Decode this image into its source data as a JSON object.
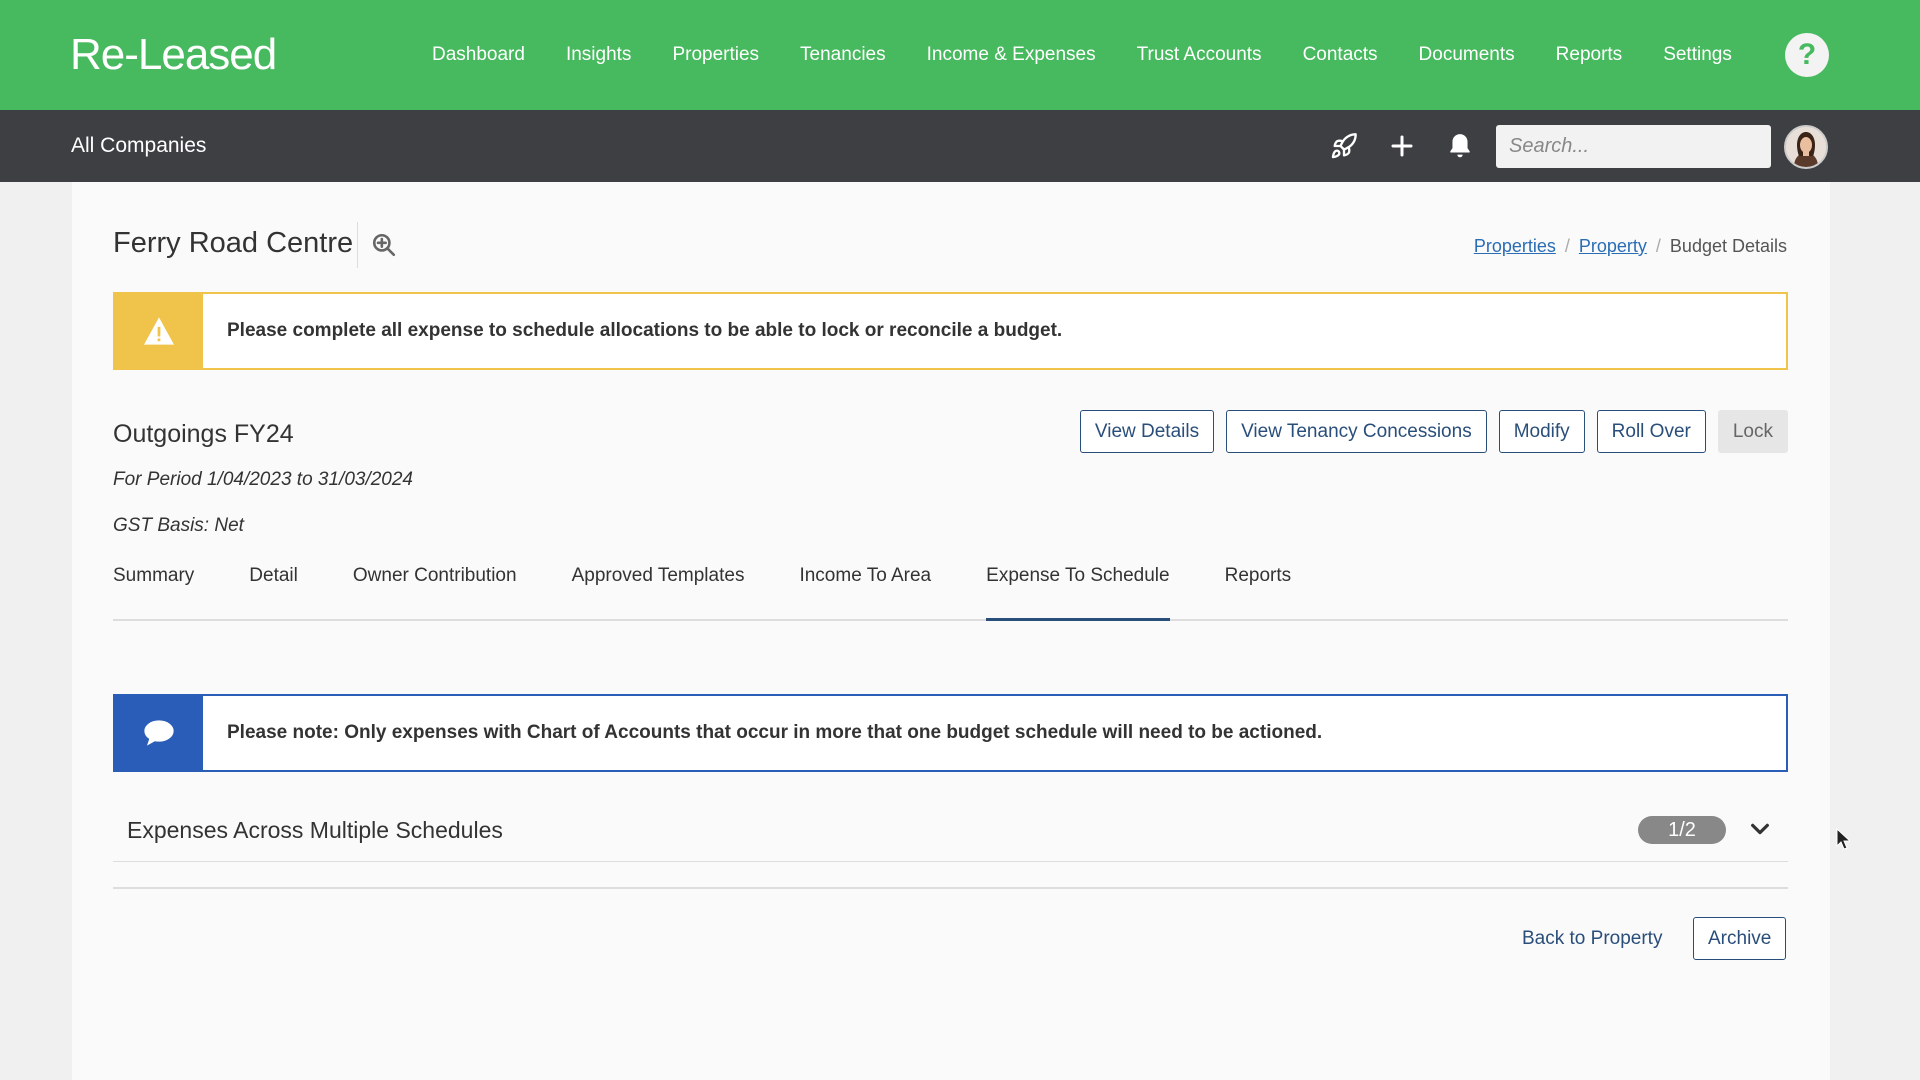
{
  "brand": {
    "logo_text": "Re-Leased"
  },
  "nav": {
    "items": [
      "Dashboard",
      "Insights",
      "Properties",
      "Tenancies",
      "Income & Expenses",
      "Trust Accounts",
      "Contacts",
      "Documents",
      "Reports",
      "Settings"
    ],
    "help_label": "?"
  },
  "subbar": {
    "company": "All Companies",
    "search_placeholder": "Search..."
  },
  "page": {
    "title": "Ferry Road Centre",
    "breadcrumb": {
      "items": [
        "Properties",
        "Property"
      ],
      "current": "Budget Details",
      "separator": "/"
    }
  },
  "warning": {
    "text": "Please complete all expense to schedule allocations to be able to lock or reconcile a budget."
  },
  "budget": {
    "title": "Outgoings FY24",
    "period": "For Period 1/04/2023 to 31/03/2024",
    "gst": "GST Basis: Net"
  },
  "actions": {
    "view_details": "View Details",
    "view_tenancy_concessions": "View Tenancy Concessions",
    "modify": "Modify",
    "roll_over": "Roll Over",
    "lock": "Lock"
  },
  "tabs": {
    "items": [
      "Summary",
      "Detail",
      "Owner Contribution",
      "Approved Templates",
      "Income To Area",
      "Expense To Schedule",
      "Reports"
    ],
    "active": "Expense To Schedule"
  },
  "note": {
    "text": "Please note: Only expenses with Chart of Accounts that occur in more that one budget schedule will need to be actioned."
  },
  "section": {
    "title": "Expenses Across Multiple Schedules",
    "pager": "1/2"
  },
  "footer": {
    "back_label": "Back to Property",
    "archive_label": "Archive"
  },
  "colors": {
    "brand_green": "#47b95e",
    "subbar": "#3d3f42",
    "warning": "#f0c34a",
    "info": "#2a5db8",
    "primary": "#2a4e7a"
  }
}
